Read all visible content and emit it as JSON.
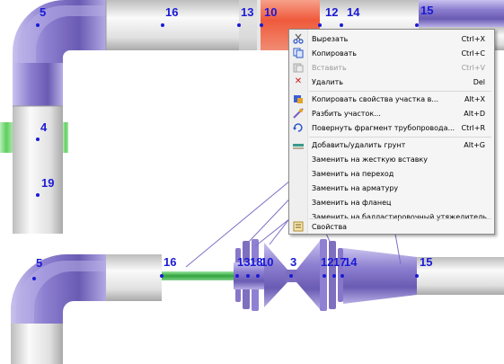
{
  "colors": {
    "pipe_purple": "#7e6fbf",
    "pipe_gray": "#cfcfcf",
    "pipe_highlight": "#f06a4a",
    "node_blue": "#1a1ad6",
    "green_insert": "#34b24a",
    "link_line": "#7b70c6"
  },
  "top_view": {
    "nodes": [
      {
        "label": "5"
      },
      {
        "label": "16"
      },
      {
        "label": "13"
      },
      {
        "label": "10"
      },
      {
        "label": "12"
      },
      {
        "label": "14"
      },
      {
        "label": "15"
      },
      {
        "label": "4"
      },
      {
        "label": "19"
      }
    ]
  },
  "bottom_view": {
    "nodes": [
      {
        "label": "5"
      },
      {
        "label": "16"
      },
      {
        "label": "13"
      },
      {
        "label": "18"
      },
      {
        "label": "10"
      },
      {
        "label": "3"
      },
      {
        "label": "12"
      },
      {
        "label": "17"
      },
      {
        "label": "14"
      },
      {
        "label": "15"
      }
    ]
  },
  "context_menu": {
    "items": [
      {
        "label": "Вырезать",
        "shortcut": "Ctrl+X",
        "icon": "scissors-icon",
        "enabled": true
      },
      {
        "label": "Копировать",
        "shortcut": "Ctrl+C",
        "icon": "copy-icon",
        "enabled": true
      },
      {
        "label": "Вставить",
        "shortcut": "Ctrl+V",
        "icon": "paste-icon",
        "enabled": false
      },
      {
        "label": "Удалить",
        "shortcut": "Del",
        "icon": "delete-x-icon",
        "enabled": true
      },
      {
        "label": "Копировать свойства участка в...",
        "shortcut": "Alt+X",
        "icon": "copy-props-icon",
        "enabled": true
      },
      {
        "label": "Разбить участок...",
        "shortcut": "Alt+D",
        "icon": "split-icon",
        "enabled": true
      },
      {
        "label": "Повернуть фрагмент трубопровода...",
        "shortcut": "Ctrl+R",
        "icon": "rotate-icon",
        "enabled": true
      },
      {
        "label": "Добавить/удалить грунт",
        "shortcut": "Alt+G",
        "icon": "soil-icon",
        "enabled": true
      },
      {
        "label": "Заменить на жесткую вставку",
        "shortcut": "",
        "icon": "",
        "enabled": true
      },
      {
        "label": "Заменить на переход",
        "shortcut": "",
        "icon": "",
        "enabled": true
      },
      {
        "label": "Заменить на арматуру",
        "shortcut": "",
        "icon": "",
        "enabled": true
      },
      {
        "label": "Заменить на фланец",
        "shortcut": "",
        "icon": "",
        "enabled": true
      },
      {
        "label": "Заменить на балластировочный утяжелитель",
        "shortcut": "",
        "icon": "",
        "enabled": true
      },
      {
        "label": "Свойства",
        "shortcut": "",
        "icon": "properties-icon",
        "enabled": true
      }
    ]
  }
}
